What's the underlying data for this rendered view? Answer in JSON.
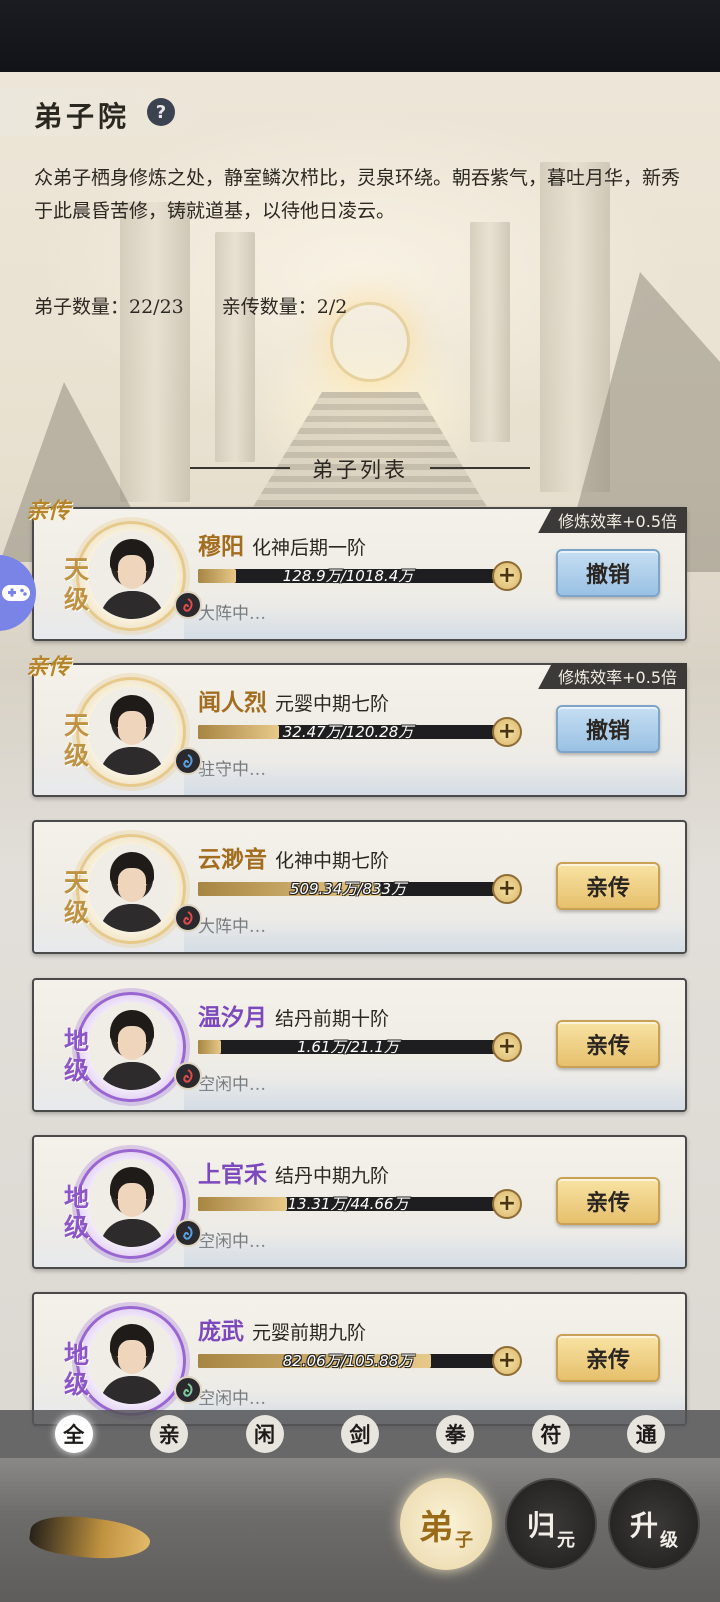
{
  "header": {
    "title": "弟子院",
    "help_icon": "?",
    "description": "众弟子栖身修炼之处，静室鳞次栉比，灵泉环绕。朝吞紫气，暮吐月华，新秀于此晨昏苦修，铸就道基，以待他日凌云。",
    "disciple_count": "弟子数量：22/23",
    "personal_count": "亲传数量：2/2",
    "list_title": "弟子列表"
  },
  "disciples": [
    {
      "badge": "亲传",
      "bonus": "修炼效率+0.5倍",
      "name": "穆阳",
      "realm": "化神后期一阶",
      "grade": "天级",
      "tier": "gold",
      "progress_text": "128.9万/1018.4万",
      "progress": 0.127,
      "status": "大阵中…",
      "action": "撤销",
      "action_style": "blue",
      "element_icon": "fire-element-icon"
    },
    {
      "badge": "亲传",
      "bonus": "修炼效率+0.5倍",
      "name": "闻人烈",
      "realm": "元婴中期七阶",
      "grade": "天级",
      "tier": "gold",
      "progress_text": "32.47万/120.28万",
      "progress": 0.27,
      "status": "驻守中…",
      "action": "撤销",
      "action_style": "blue",
      "element_icon": "water-element-icon"
    },
    {
      "badge": "",
      "bonus": "",
      "name": "云渺音",
      "realm": "化神中期七阶",
      "grade": "天级",
      "tier": "gold",
      "progress_text": "509.34万/833万",
      "progress": 0.611,
      "status": "大阵中…",
      "action": "亲传",
      "action_style": "gold",
      "element_icon": "fire-element-icon"
    },
    {
      "badge": "",
      "bonus": "",
      "name": "温汐月",
      "realm": "结丹前期十阶",
      "grade": "地级",
      "tier": "purple",
      "progress_text": "1.61万/21.1万",
      "progress": 0.076,
      "status": "空闲中…",
      "action": "亲传",
      "action_style": "gold",
      "element_icon": "fire-element-icon"
    },
    {
      "badge": "",
      "bonus": "",
      "name": "上官禾",
      "realm": "结丹中期九阶",
      "grade": "地级",
      "tier": "purple",
      "progress_text": "13.31万/44.66万",
      "progress": 0.298,
      "status": "空闲中…",
      "action": "亲传",
      "action_style": "gold",
      "element_icon": "water-element-icon"
    },
    {
      "badge": "",
      "bonus": "",
      "name": "庞武",
      "realm": "元婴前期九阶",
      "grade": "地级",
      "tier": "purple",
      "progress_text": "82.06万/105.88万",
      "progress": 0.775,
      "status": "空闲中…",
      "action": "亲传",
      "action_style": "gold",
      "element_icon": "wind-element-icon"
    }
  ],
  "filter_tabs": [
    "全",
    "亲",
    "闲",
    "剑",
    "拳",
    "符",
    "通"
  ],
  "active_filter": "全",
  "bottom_nav": [
    {
      "main": "弟",
      "sub": "子"
    },
    {
      "main": "归",
      "sub": "元"
    },
    {
      "main": "升",
      "sub": "级"
    }
  ],
  "colors": {
    "gold_name": "#a36d20",
    "purple_name": "#7c48bd",
    "revoke_button": "#99c1e4",
    "personal_button": "#e6c06c"
  }
}
